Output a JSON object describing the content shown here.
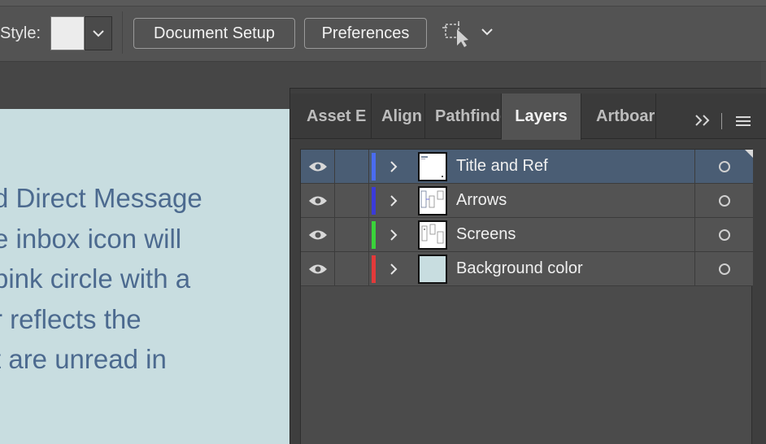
{
  "control_bar": {
    "style_label": "Style:",
    "style_swatch_color": "#ececec",
    "document_setup_label": "Document Setup",
    "preferences_label": "Preferences",
    "arrange_icon": "arrange-documents-icon"
  },
  "artboard": {
    "background_color": "#c8dde0",
    "text_color": "#4c6a8f",
    "lines": [
      "d Direct Message",
      "e inbox icon will",
      "pink circle with a",
      "r reflects the",
      "t are unread in"
    ]
  },
  "panel": {
    "tabs": [
      {
        "label": "Asset E",
        "active": false
      },
      {
        "label": "Align",
        "active": false
      },
      {
        "label": "Pathfinder",
        "active": false
      },
      {
        "label": "Layers",
        "active": true
      },
      {
        "label": "Artboards",
        "active": false
      }
    ],
    "more_icon": "double-chevron-right-icon",
    "menu_icon": "panel-menu-icon",
    "layers": [
      {
        "name": "Title and Ref",
        "color": "#4a6cf0",
        "selected": true,
        "thumb": "document"
      },
      {
        "name": "Arrows",
        "color": "#3b3bd9",
        "selected": false,
        "thumb": "screens"
      },
      {
        "name": "Screens",
        "color": "#3ad33a",
        "selected": false,
        "thumb": "screens"
      },
      {
        "name": "Background color",
        "color": "#e23a3a",
        "selected": false,
        "thumb": "background"
      }
    ]
  }
}
